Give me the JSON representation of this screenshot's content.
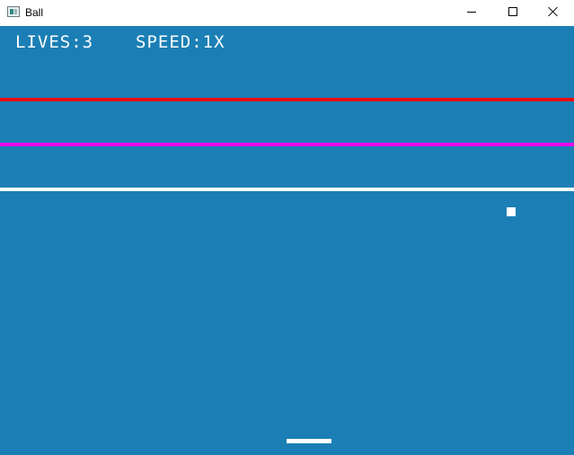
{
  "window": {
    "title": "Ball",
    "icon": "app-window-icon",
    "controls": {
      "minimize_icon": "minimize-icon",
      "maximize_icon": "maximize-icon",
      "close_icon": "close-icon"
    }
  },
  "hud": {
    "lives_label": "LIVES:",
    "lives_value": "3",
    "speed_label": "SPEED:",
    "speed_value": "1X"
  },
  "colors": {
    "background": "#1b7fb5",
    "stripe_red": "#ee0a0a",
    "stripe_magenta": "#ee00ee",
    "stripe_white": "#ffffff",
    "ball": "#ffffff",
    "paddle": "#ffffff",
    "hud_text": "#ffffff"
  }
}
